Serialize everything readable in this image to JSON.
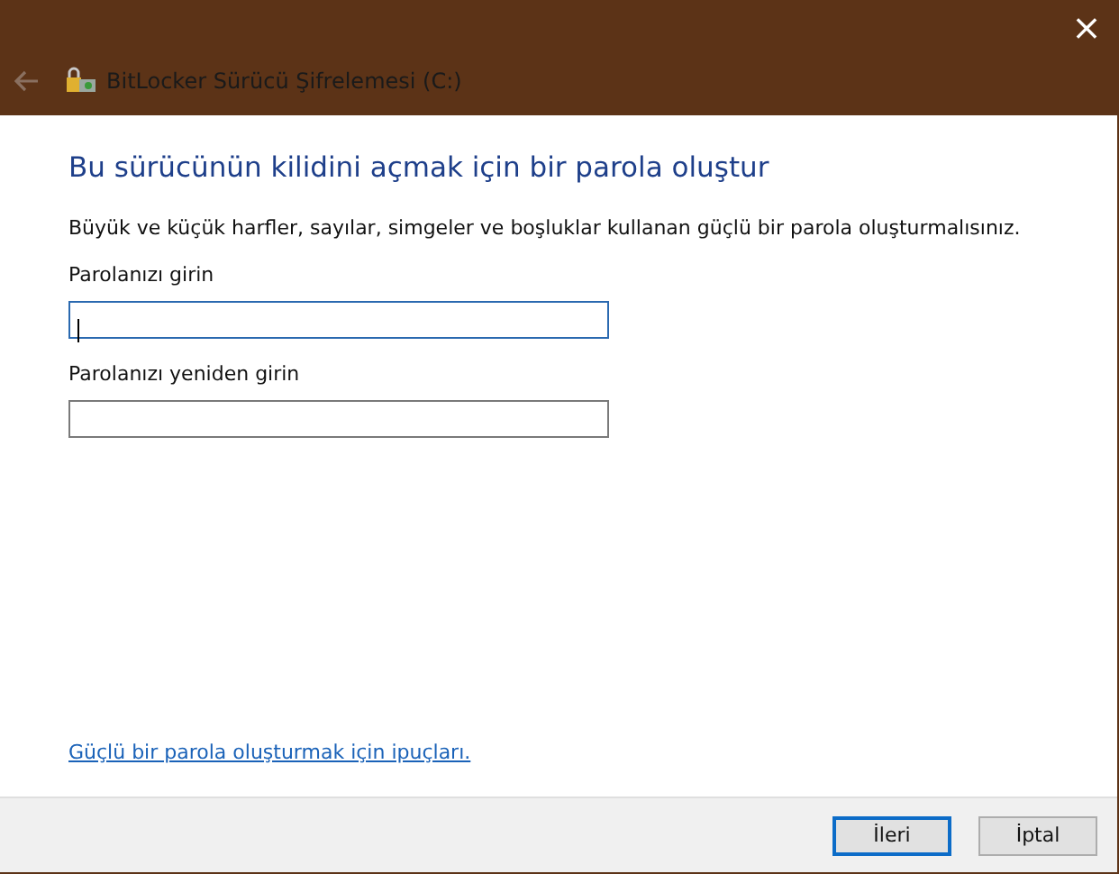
{
  "window": {
    "title": "BitLocker Sürücü Şifrelemesi (C:)",
    "close": "×"
  },
  "heading": "Bu sürücünün kilidini açmak için bir parola oluştur",
  "description": "Büyük ve küçük harfler, sayılar, simgeler ve boşluklar kullanan güçlü bir parola oluşturmalısınız.",
  "fields": [
    {
      "label": "Parolanızı girin",
      "focused": true
    },
    {
      "label": "Parolanızı yeniden girin",
      "focused": false
    }
  ],
  "link": "Güçlü bir parola oluşturmak için ipuçları.",
  "buttons": [
    {
      "label": "İleri",
      "default": true
    },
    {
      "label": "İptal",
      "default": false
    }
  ]
}
